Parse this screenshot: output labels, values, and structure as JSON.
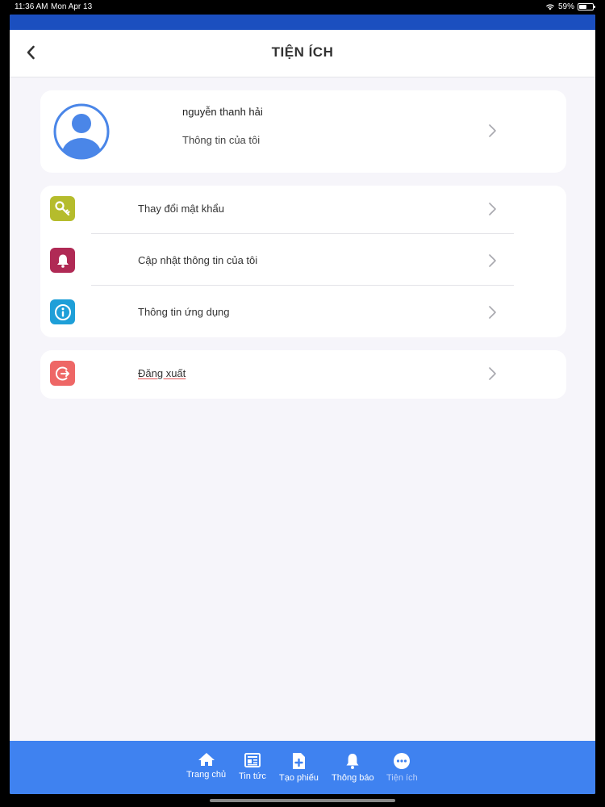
{
  "status_bar": {
    "time": "11:36 AM",
    "date": "Mon Apr 13",
    "battery_text": "59%",
    "battery_level": 0.59
  },
  "header": {
    "title": "TIỆN ÍCH",
    "back_icon": "chevron-left-icon"
  },
  "profile": {
    "name": "nguyễn thanh hải",
    "subtitle": "Thông tin của tôi",
    "avatar_icon": "user-avatar-icon"
  },
  "menu": {
    "items": [
      {
        "label": "Thay đổi mật khẩu",
        "icon": "key-icon",
        "color": "#b5bc2c"
      },
      {
        "label": "Cập nhật thông tin của tôi",
        "icon": "bell-icon",
        "color": "#b02a55"
      },
      {
        "label": "Thông tin ứng dụng",
        "icon": "info-icon",
        "color": "#1e9fd8"
      }
    ]
  },
  "logout": {
    "label": "Đăng xuất",
    "icon": "logout-icon",
    "color": "#ee6766"
  },
  "tabbar": {
    "items": [
      {
        "label": "Trang chủ",
        "icon": "home-icon",
        "active": true
      },
      {
        "label": "Tin tức",
        "icon": "news-icon",
        "active": true
      },
      {
        "label": "Tạo phiếu",
        "icon": "add-document-icon",
        "active": true
      },
      {
        "label": "Thông báo",
        "icon": "bell-icon",
        "active": true
      },
      {
        "label": "Tiện ích",
        "icon": "more-icon",
        "active": false
      }
    ]
  },
  "colors": {
    "accent_blue": "#3f82f0",
    "top_strip": "#1b4fbf",
    "background": "#f6f5fa"
  }
}
